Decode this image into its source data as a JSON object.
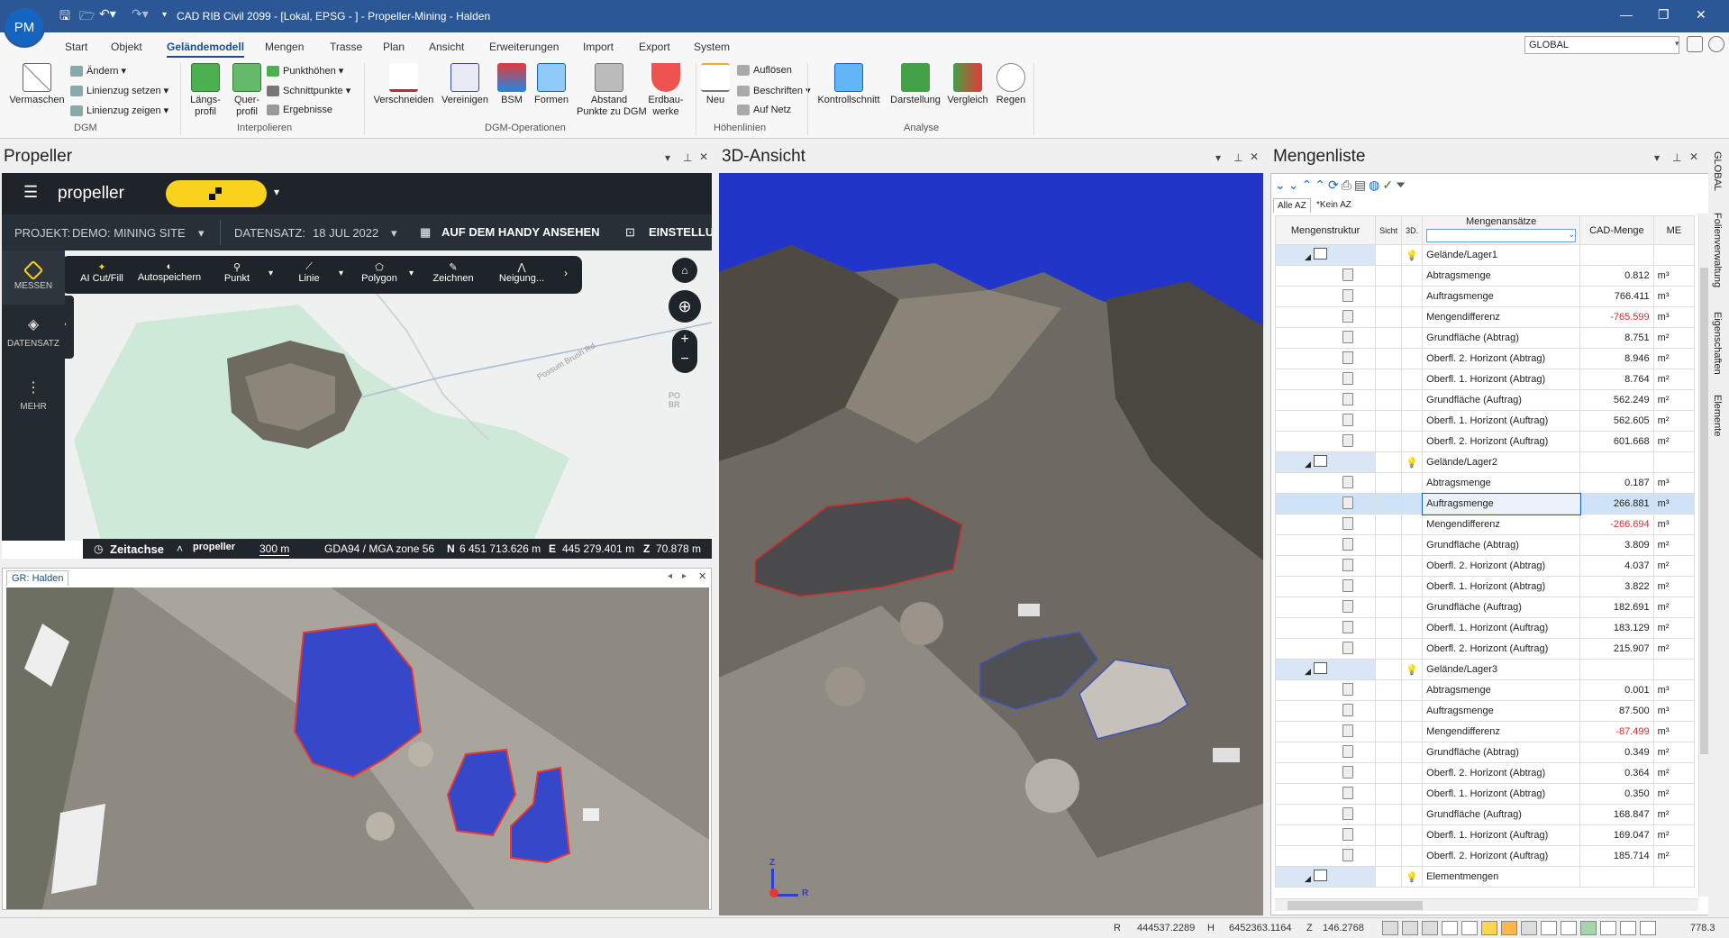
{
  "app": {
    "title": "CAD RIB Civil 2099 - [Lokal, EPSG - ] - Propeller-Mining - Halden",
    "avatar": "PM",
    "global": "GLOBAL"
  },
  "menu": [
    "Start",
    "Objekt",
    "Geländemodell",
    "Mengen",
    "Trasse",
    "Plan",
    "Ansicht",
    "Erweiterungen",
    "Import",
    "Export",
    "System"
  ],
  "ribbon": {
    "vermaschen": "Vermaschen",
    "aendern": "Ändern",
    "linienzug_setzen": "Linienzug setzen",
    "linienzug_zeigen": "Linienzug zeigen",
    "laengsprofil": "Längs-\nprofil",
    "querprofil": "Quer-\nprofil",
    "punkthoehen": "Punkthöhen",
    "schnittpunkte": "Schnittpunkte",
    "ergebnisse": "Ergebnisse",
    "verschneiden": "Verschneiden",
    "vereinigen": "Vereinigen",
    "bsm": "BSM",
    "formen": "Formen",
    "abstand": "Abstand\nPunkte zu DGM",
    "erdbauwerke": "Erdbau-\nwerke",
    "neu": "Neu",
    "aufloesen": "Auflösen",
    "beschriften": "Beschriften",
    "auf_netz": "Auf Netz",
    "kontrollschnitt": "Kontrollschnitt",
    "darstellung": "Darstellung",
    "vergleich": "Vergleich",
    "regen": "Regen",
    "groups": {
      "dgm": "DGM",
      "interpolieren": "Interpolieren",
      "dgm_ops": "DGM-Operationen",
      "hoehenlinien": "Höhenlinien",
      "analyse": "Analyse"
    }
  },
  "propeller": {
    "panel_title": "Propeller",
    "logo": "propeller",
    "projekt_label": "PROJEKT:",
    "projekt": "DEMO: MINING SITE",
    "datensatz_label": "DATENSATZ:",
    "datensatz": "18 JUL 2022",
    "handy": "AUF DEM HANDY ANSEHEN",
    "einstellungen": "EINSTELLU",
    "side": {
      "messen": "MESSEN",
      "datensatz": "DATENSATZ",
      "mehr": "MEHR"
    },
    "tools": [
      "AI Cut/Fill",
      "Autospeichern",
      "Punkt",
      "Linie",
      "Polygon",
      "Zeichnen",
      "Neigung..."
    ],
    "road": "Possum Brush Rd",
    "map_label": "PO\nBR",
    "zeitachse": "Zeitachse",
    "scale": "300 m",
    "crs": "GDA94 / MGA zone 56",
    "n_label": "N",
    "n": "6 451 713.626 m",
    "e_label": "E",
    "e": "445 279.401 m",
    "z_label": "Z",
    "z": "70.878 m"
  },
  "gr_panel": {
    "tab": "GR: Halden"
  },
  "view3d": {
    "title": "3D-Ansicht",
    "axis_z": "Z",
    "axis_r": "R"
  },
  "mengenliste": {
    "title": "Mengenliste",
    "filter_all": "Alle AZ",
    "filter_none": "*Kein AZ",
    "headers": {
      "struktur": "Mengenstruktur",
      "sicht": "Sicht",
      "d3": "3D.",
      "ansaetze": "Mengenansätze",
      "menge": "CAD-Menge",
      "me": "ME"
    },
    "rows": [
      {
        "type": "group",
        "name": "Gelände/Lager1"
      },
      {
        "name": "Abtragsmenge",
        "val": "0.812",
        "unit": "m³"
      },
      {
        "name": "Auftragsmenge",
        "val": "766.411",
        "unit": "m³"
      },
      {
        "name": "Mengendifferenz",
        "val": "-765.599",
        "unit": "m³",
        "neg": true
      },
      {
        "name": "Grundfläche (Abtrag)",
        "val": "8.751",
        "unit": "m²"
      },
      {
        "name": "Oberfl. 2. Horizont (Abtrag)",
        "val": "8.946",
        "unit": "m²"
      },
      {
        "name": "Oberfl. 1. Horizont (Abtrag)",
        "val": "8.764",
        "unit": "m²"
      },
      {
        "name": "Grundfläche (Auftrag)",
        "val": "562.249",
        "unit": "m²"
      },
      {
        "name": "Oberfl. 1. Horizont (Auftrag)",
        "val": "562.605",
        "unit": "m²"
      },
      {
        "name": "Oberfl. 2. Horizont (Auftrag)",
        "val": "601.668",
        "unit": "m²"
      },
      {
        "type": "group",
        "name": "Gelände/Lager2"
      },
      {
        "name": "Abtragsmenge",
        "val": "0.187",
        "unit": "m³"
      },
      {
        "name": "Auftragsmenge",
        "val": "266.881",
        "unit": "m³",
        "selected": true
      },
      {
        "name": "Mengendifferenz",
        "val": "-266.694",
        "unit": "m³",
        "neg": true
      },
      {
        "name": "Grundfläche (Abtrag)",
        "val": "3.809",
        "unit": "m²"
      },
      {
        "name": "Oberfl. 2. Horizont (Abtrag)",
        "val": "4.037",
        "unit": "m²"
      },
      {
        "name": "Oberfl. 1. Horizont (Abtrag)",
        "val": "3.822",
        "unit": "m²"
      },
      {
        "name": "Grundfläche (Auftrag)",
        "val": "182.691",
        "unit": "m²"
      },
      {
        "name": "Oberfl. 1. Horizont (Auftrag)",
        "val": "183.129",
        "unit": "m²"
      },
      {
        "name": "Oberfl. 2. Horizont (Auftrag)",
        "val": "215.907",
        "unit": "m²"
      },
      {
        "type": "group",
        "name": "Gelände/Lager3"
      },
      {
        "name": "Abtragsmenge",
        "val": "0.001",
        "unit": "m³"
      },
      {
        "name": "Auftragsmenge",
        "val": "87.500",
        "unit": "m³"
      },
      {
        "name": "Mengendifferenz",
        "val": "-87.499",
        "unit": "m³",
        "neg": true
      },
      {
        "name": "Grundfläche (Abtrag)",
        "val": "0.349",
        "unit": "m²"
      },
      {
        "name": "Oberfl. 2. Horizont (Abtrag)",
        "val": "0.364",
        "unit": "m²"
      },
      {
        "name": "Oberfl. 1. Horizont (Abtrag)",
        "val": "0.350",
        "unit": "m²"
      },
      {
        "name": "Grundfläche (Auftrag)",
        "val": "168.847",
        "unit": "m²"
      },
      {
        "name": "Oberfl. 1. Horizont (Auftrag)",
        "val": "169.047",
        "unit": "m²"
      },
      {
        "name": "Oberfl. 2. Horizont (Auftrag)",
        "val": "185.714",
        "unit": "m²"
      },
      {
        "type": "group",
        "name": "Elementmengen"
      }
    ]
  },
  "side_strip": [
    "GLOBAL",
    "Folienverwaltung",
    "Eigenschaften",
    "Elemente"
  ],
  "status": {
    "r_label": "R",
    "r": "444537.2289",
    "h_label": "H",
    "h": "6452363.1164",
    "z_label": "Z",
    "z": "146.2768",
    "zoom": "778.3"
  },
  "colors": {
    "titlebar": "#2b5797",
    "propeller_yellow": "#f8d21c",
    "selection": "#cfe2f6",
    "negative": "#d32f2f"
  }
}
